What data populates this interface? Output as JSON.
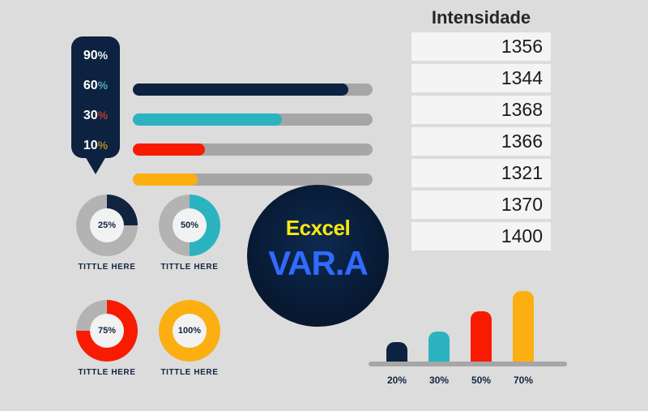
{
  "page": {
    "background_color": "#dcdcdc",
    "navy": "#0d2240",
    "teal": "#2bb3c0",
    "red": "#f81b02",
    "amber": "#fcaf11",
    "gray": "#a6a6a6"
  },
  "progress_panel": {
    "rows": [
      {
        "value": "90",
        "symbol": "%",
        "fill_percent": 90,
        "color": "#0d2240",
        "symbol_color": "#e8eef5"
      },
      {
        "value": "60",
        "symbol": "%",
        "fill_percent": 62,
        "color": "#2bb3c0",
        "symbol_color": "#4fa8bd"
      },
      {
        "value": "30",
        "symbol": "%",
        "fill_percent": 30,
        "color": "#f81b02",
        "symbol_color": "#c0392b"
      },
      {
        "value": "10",
        "symbol": "%",
        "fill_percent": 27,
        "color": "#fcaf11",
        "symbol_color": "#b08a2a"
      }
    ]
  },
  "donuts": [
    {
      "value": "25%",
      "percent": 25,
      "color": "#10243f",
      "label": "TITTLE HERE"
    },
    {
      "value": "50%",
      "percent": 50,
      "color": "#2bb3c0",
      "label": "TITTLE HERE"
    },
    {
      "value": "75%",
      "percent": 75,
      "color": "#f81b02",
      "label": "TITTLE HERE"
    },
    {
      "value": "100%",
      "percent": 100,
      "color": "#fcaf11",
      "label": "TITTLE HERE"
    }
  ],
  "brand_badge": {
    "top_text": "Ecxcel",
    "main_text": "VAR.A",
    "top_color": "#fbe90f",
    "main_color": "#2f6bff"
  },
  "table": {
    "header": "Intensidade",
    "rows": [
      "1356",
      "1344",
      "1368",
      "1366",
      "1321",
      "1370",
      "1400"
    ]
  },
  "chart_data": {
    "type": "bar",
    "title": "",
    "xlabel": "",
    "ylabel": "",
    "categories": [
      "20%",
      "30%",
      "50%",
      "70%"
    ],
    "values": [
      20,
      30,
      50,
      70
    ],
    "ylim": [
      0,
      80
    ],
    "grid": false,
    "legend": "none",
    "colors": [
      "#0d2240",
      "#2bb3c0",
      "#f81b02",
      "#fcaf11"
    ]
  }
}
